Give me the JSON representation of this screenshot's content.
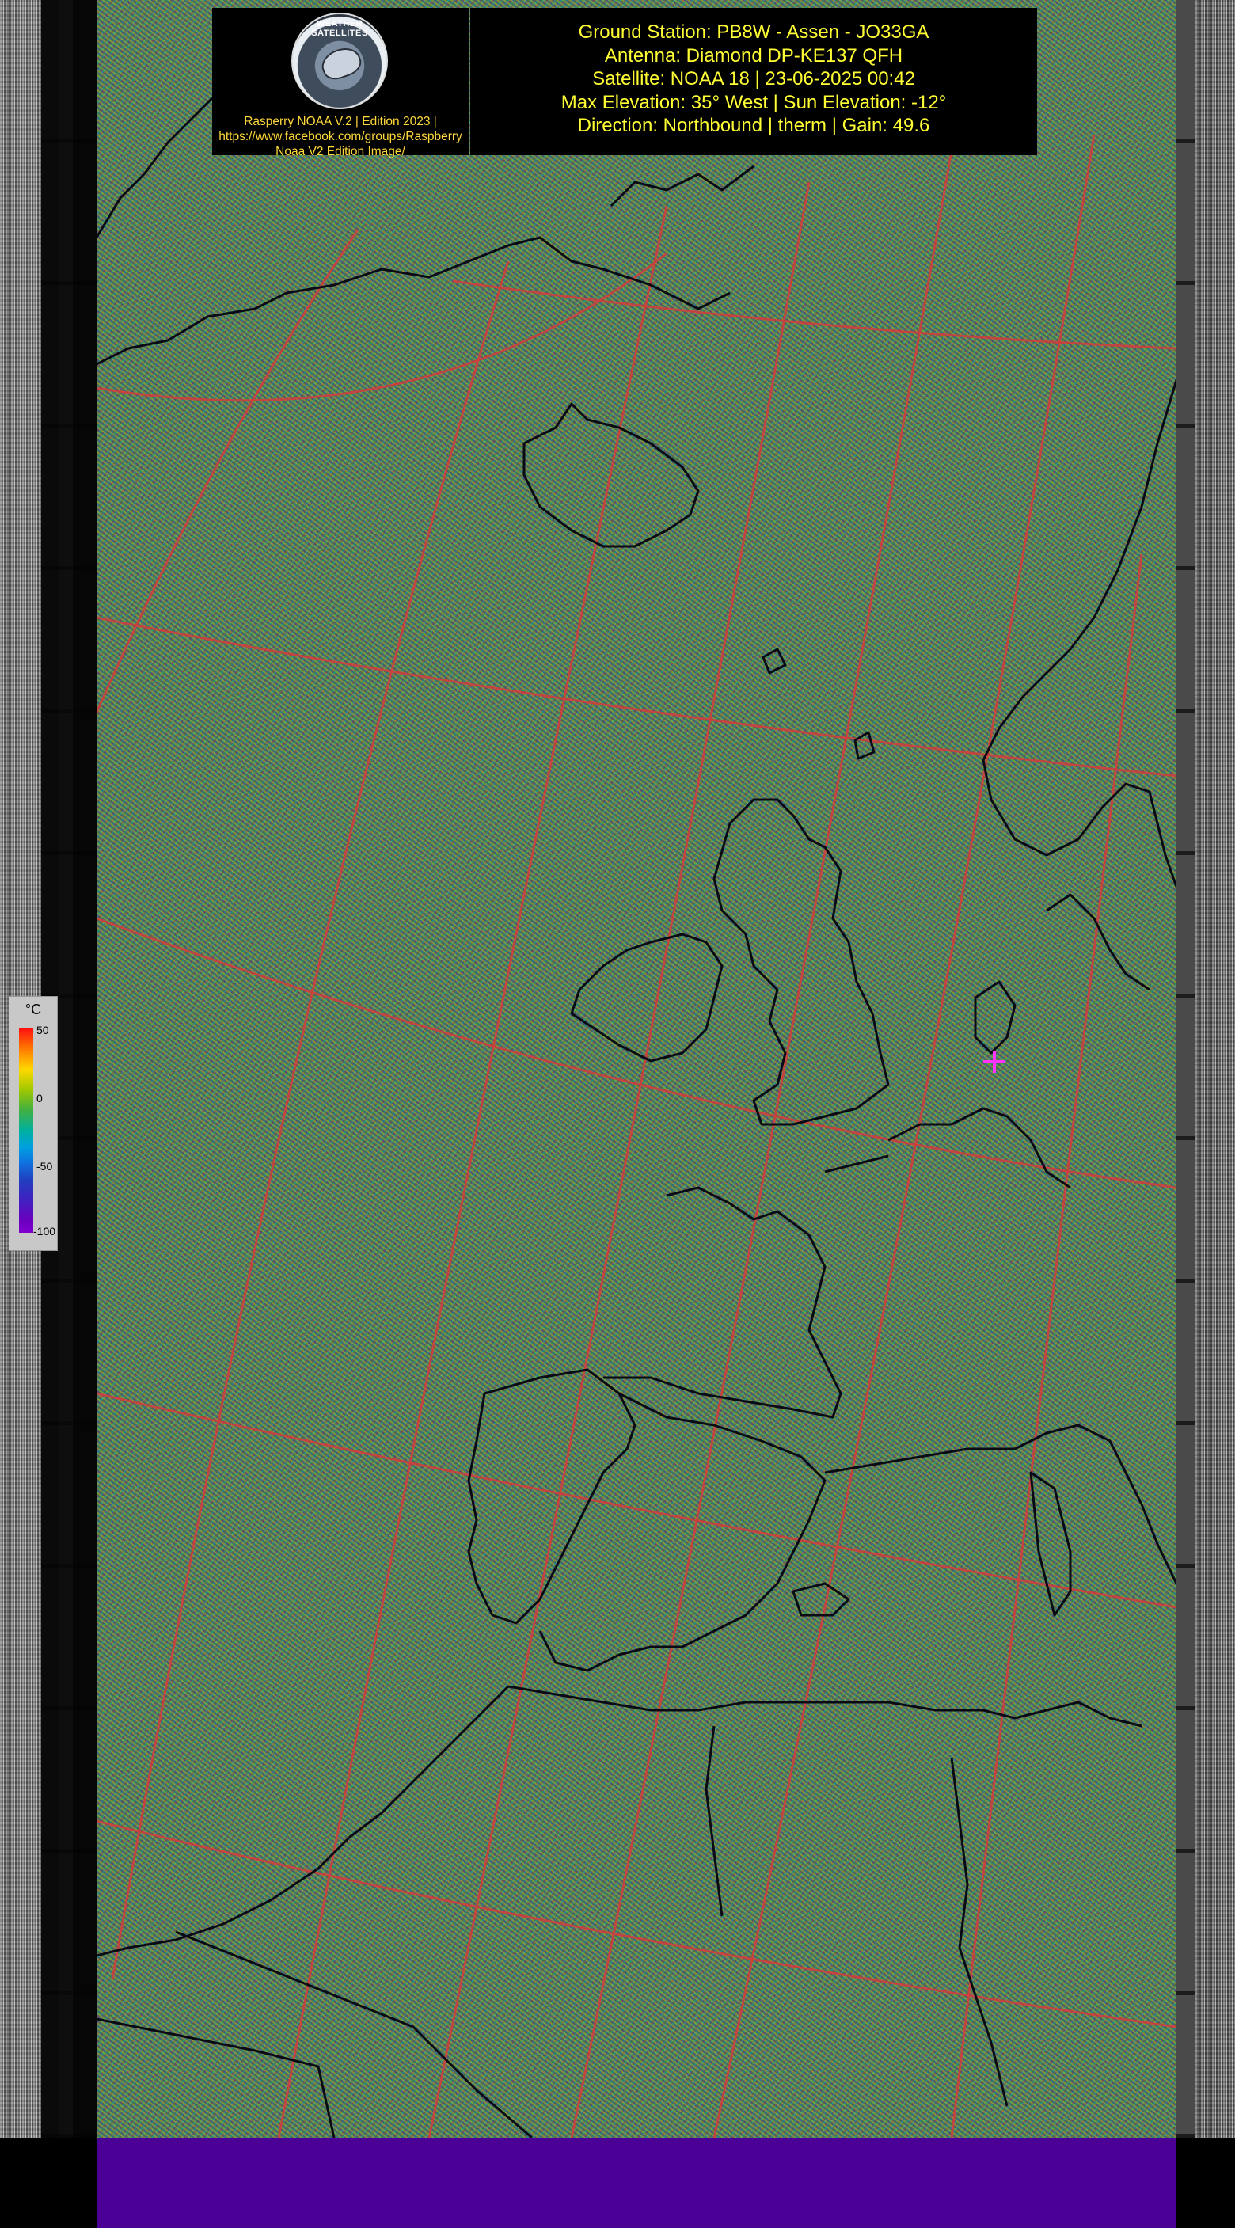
{
  "header": {
    "logo_label": "WEATHER SATELLITES",
    "left_lines": [
      "Rasperry NOAA V.2 | Edition 2023 |",
      "https://www.facebook.com/groups/Raspberry",
      "Noaa V2 Edition Image/"
    ],
    "right_lines": [
      "Ground Station: PB8W - Assen - JO33GA",
      "Antenna: Diamond DP-KE137 QFH",
      "Satellite: NOAA 18 | 23-06-2025 00:42",
      "Max Elevation: 35° West | Sun Elevation: -12°",
      "Direction: Northbound | therm | Gain: 49.6"
    ]
  },
  "legend": {
    "unit": "°C",
    "ticks": [
      "50",
      "0",
      "-50",
      "-100"
    ]
  },
  "colors": {
    "header_text": "#ffff33",
    "left_info_text": "#ffd83c",
    "bottom_band": "#4b0096",
    "graticule": "#d23c3c",
    "marker": "#ff33ff"
  },
  "icons": {
    "marker": "ground-station-cross-icon",
    "logo": "weather-satellites-logo-icon"
  }
}
